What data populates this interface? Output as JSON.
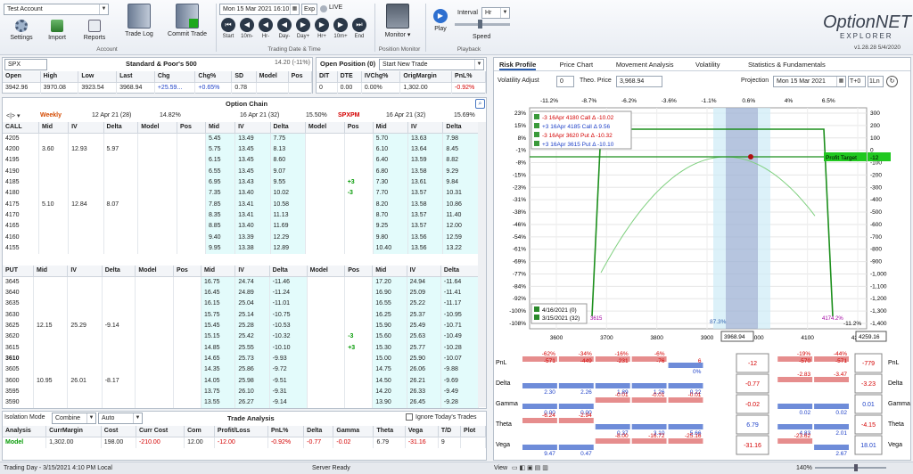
{
  "ribbon": {
    "account": "Test Account",
    "buttons": {
      "settings": "Settings",
      "import": "Import",
      "reports": "Reports",
      "trade_log": "Trade Log",
      "commit": "Commit Trade",
      "monitor": "Monitor",
      "play": "Play",
      "speed": "Speed"
    },
    "groups": {
      "account": "Account",
      "trading": "Trading Date & Time",
      "position_monitor": "Position Monitor",
      "playback": "Playback"
    },
    "datetime": "Mon 15 Mar 2021 16:10",
    "exp": "Exp",
    "live": "LIVE",
    "nav": [
      "Start",
      "10m-",
      "Hr-",
      "Day-",
      "Day+",
      "Hr+",
      "10m+",
      "End"
    ],
    "interval_label": "Interval",
    "interval": "Hr",
    "logo_main": "OptionNET",
    "logo_sub": "EXPLORER",
    "version": "v1.28.28  5/4/2020"
  },
  "symbol": {
    "sym": "SPX",
    "name": "Standard & Poor's 500",
    "iv": "14.20 (-11%)",
    "headers": [
      "Open",
      "High",
      "Low",
      "Last",
      "Chg",
      "Chg%",
      "SD",
      "Model",
      "Pos"
    ],
    "values": [
      "3942.96",
      "3970.08",
      "3923.54",
      "3968.94",
      "+25.59...",
      "+0.65%",
      "0.78",
      "",
      ""
    ]
  },
  "open_pos": {
    "title": "Open Position (0)",
    "trade": "Start New Trade",
    "headers": [
      "DIT",
      "DTE",
      "IVChg%",
      "OrigMargin",
      "PnL%"
    ],
    "values": [
      "0",
      "0.00",
      "0.00%",
      "1,302.00",
      "-0.92%"
    ]
  },
  "chain": {
    "title": "Option Chain",
    "series1": "Weekly",
    "exp1": "12 Apr 21 (28)",
    "iv1": "14.82%",
    "exp2": "16 Apr 21 (32)",
    "iv2": "15.50%",
    "series3": "SPXPM",
    "exp3": "16 Apr 21 (32)",
    "iv3": "15.69%",
    "call_headers": [
      "CALL",
      "Mid",
      "IV",
      "Delta",
      "Model",
      "Pos",
      "Mid",
      "IV",
      "Delta",
      "Model",
      "Pos",
      "Mid",
      "IV",
      "Delta"
    ],
    "put_headers": [
      "PUT",
      "Mid",
      "IV",
      "Delta",
      "Model",
      "Pos",
      "Mid",
      "IV",
      "Delta",
      "Model",
      "Pos",
      "Mid",
      "IV",
      "Delta"
    ],
    "calls": [
      [
        "4205",
        "",
        "",
        "",
        "",
        "",
        "5.45",
        "13.49",
        "7.75",
        "",
        "",
        "5.70",
        "13.63",
        "7.98"
      ],
      [
        "4200",
        "3.60",
        "12.93",
        "5.97",
        "",
        "",
        "5.75",
        "13.45",
        "8.13",
        "",
        "",
        "6.10",
        "13.64",
        "8.45"
      ],
      [
        "4195",
        "",
        "",
        "",
        "",
        "",
        "6.15",
        "13.45",
        "8.60",
        "",
        "",
        "6.40",
        "13.59",
        "8.82"
      ],
      [
        "4190",
        "",
        "",
        "",
        "",
        "",
        "6.55",
        "13.45",
        "9.07",
        "",
        "",
        "6.80",
        "13.58",
        "9.29"
      ],
      [
        "4185",
        "",
        "",
        "",
        "",
        "",
        "6.95",
        "13.43",
        "9.55",
        "",
        "+3",
        "7.30",
        "13.61",
        "9.84"
      ],
      [
        "4180",
        "",
        "",
        "",
        "",
        "",
        "7.35",
        "13.40",
        "10.02",
        "",
        "-3",
        "7.70",
        "13.57",
        "10.31"
      ],
      [
        "4175",
        "5.10",
        "12.84",
        "8.07",
        "",
        "",
        "7.85",
        "13.41",
        "10.58",
        "",
        "",
        "8.20",
        "13.58",
        "10.86"
      ],
      [
        "4170",
        "",
        "",
        "",
        "",
        "",
        "8.35",
        "13.41",
        "11.13",
        "",
        "",
        "8.70",
        "13.57",
        "11.40"
      ],
      [
        "4165",
        "",
        "",
        "",
        "",
        "",
        "8.85",
        "13.40",
        "11.69",
        "",
        "",
        "9.25",
        "13.57",
        "12.00"
      ],
      [
        "4160",
        "",
        "",
        "",
        "",
        "",
        "9.40",
        "13.39",
        "12.29",
        "",
        "",
        "9.80",
        "13.56",
        "12.59"
      ],
      [
        "4155",
        "",
        "",
        "",
        "",
        "",
        "9.95",
        "13.38",
        "12.89",
        "",
        "",
        "10.40",
        "13.56",
        "13.22"
      ]
    ],
    "puts": [
      [
        "3645",
        "",
        "",
        "",
        "",
        "",
        "16.75",
        "24.74",
        "-11.46",
        "",
        "",
        "17.20",
        "24.94",
        "-11.64"
      ],
      [
        "3640",
        "",
        "",
        "",
        "",
        "",
        "16.45",
        "24.89",
        "-11.24",
        "",
        "",
        "16.90",
        "25.09",
        "-11.41"
      ],
      [
        "3635",
        "",
        "",
        "",
        "",
        "",
        "16.15",
        "25.04",
        "-11.01",
        "",
        "",
        "16.55",
        "25.22",
        "-11.17"
      ],
      [
        "3630",
        "",
        "",
        "",
        "",
        "",
        "15.75",
        "25.14",
        "-10.75",
        "",
        "",
        "16.25",
        "25.37",
        "-10.95"
      ],
      [
        "3625",
        "12.15",
        "25.29",
        "-9.14",
        "",
        "",
        "15.45",
        "25.28",
        "-10.53",
        "",
        "",
        "15.90",
        "25.49",
        "-10.71"
      ],
      [
        "3620",
        "",
        "",
        "",
        "",
        "",
        "15.15",
        "25.42",
        "-10.32",
        "",
        "-3",
        "15.60",
        "25.63",
        "-10.49"
      ],
      [
        "3615",
        "",
        "",
        "",
        "",
        "",
        "14.85",
        "25.55",
        "-10.10",
        "",
        "+3",
        "15.30",
        "25.77",
        "-10.28"
      ],
      [
        "3610",
        "",
        "",
        "",
        "",
        "",
        "14.65",
        "25.73",
        "-9.93",
        "",
        "",
        "15.00",
        "25.90",
        "-10.07"
      ],
      [
        "3605",
        "",
        "",
        "",
        "",
        "",
        "14.35",
        "25.86",
        "-9.72",
        "",
        "",
        "14.75",
        "26.06",
        "-9.88"
      ],
      [
        "3600",
        "10.95",
        "26.01",
        "-8.17",
        "",
        "",
        "14.05",
        "25.98",
        "-9.51",
        "",
        "",
        "14.50",
        "26.21",
        "-9.69"
      ],
      [
        "3595",
        "",
        "",
        "",
        "",
        "",
        "13.75",
        "26.10",
        "-9.31",
        "",
        "",
        "14.20",
        "26.33",
        "-9.49"
      ],
      [
        "3590",
        "",
        "",
        "",
        "",
        "",
        "13.55",
        "26.27",
        "-9.14",
        "",
        "",
        "13.90",
        "26.45",
        "-9.28"
      ]
    ]
  },
  "analysis": {
    "title": "Trade Analysis",
    "iso_label": "Isolation Mode",
    "iso": "Combine",
    "auto": "Auto",
    "ignore": "Ignore Today's Trades",
    "headers": [
      "Analysis",
      "CurrMargin",
      "Cost",
      "Curr Cost",
      "Com",
      "Profit/Loss",
      "PnL%",
      "Delta",
      "Gamma",
      "Theta",
      "Vega",
      "T/D",
      "Plot"
    ],
    "values": [
      "Model",
      "1,302.00",
      "198.00",
      "-210.00",
      "12.00",
      "-12.00",
      "-0.92%",
      "-0.77",
      "-0.02",
      "6.79",
      "-31.16",
      "9",
      ""
    ]
  },
  "status": {
    "left": "Trading Day - 3/15/2021 4:10 PM Local",
    "server": "Server Ready",
    "view": "View",
    "zoom": "140%"
  },
  "right": {
    "tabs": [
      "Risk Profile",
      "Price Chart",
      "Movement Analysis",
      "Volatility",
      "Statistics & Fundamentals"
    ],
    "vol_adj_label": "Volatility Adjust",
    "vol_adj": "0",
    "theo_label": "Theo. Price",
    "theo": "3,968.94",
    "proj_label": "Projection",
    "proj": "Mon 15 Mar 2021",
    "tplus": "T+0",
    "ln": "1Ln",
    "top_pcts": [
      "-11.2%",
      "-8.7%",
      "-6.2%",
      "-3.6%",
      "-1.1%",
      "0.6%",
      "4%",
      "6.5%"
    ],
    "left_axis": [
      "23%",
      "15%",
      "8%",
      "-1%",
      "-8%",
      "-15%",
      "-23%",
      "-31%",
      "-38%",
      "-46%",
      "-54%",
      "-61%",
      "-69%",
      "-77%",
      "-84%",
      "-92%",
      "-100%",
      "-108%"
    ],
    "right_axis": [
      "300",
      "200",
      "100",
      "0",
      "-100",
      "-200",
      "-300",
      "-400",
      "-500",
      "-600",
      "-700",
      "-800",
      "-900",
      "-1,000",
      "-1,100",
      "-1,200",
      "-1,300",
      "-1,400"
    ],
    "x_axis": [
      "3600",
      "3700",
      "3800",
      "3900",
      "4000",
      "4100",
      "4200"
    ],
    "price_box": "3968.94",
    "right_box": "4259.16",
    "legend": [
      "-3 16Apr 4180 Call Δ  -10.02",
      "+3 16Apr 4185 Call Δ    9.56",
      "-3 16Apr 3620 Put Δ  -10.32",
      "+3 16Apr 3615 Put Δ  -10.10"
    ],
    "legend2": [
      "4/16/2021 (0)",
      "3/15/2021 (32)"
    ],
    "profit_target": "Profit Target",
    "pt_val": "-12",
    "band_label": "87.3%",
    "left_label": "3615",
    "right_label": "4174.2%",
    "bottom_right": "-11.2%",
    "greeks": {
      "rows": [
        "PnL",
        "Delta",
        "Gamma",
        "Theta",
        "Vega"
      ],
      "pnl": [
        "-62%",
        "-34%",
        "-16%",
        "-6%",
        "0%",
        "",
        "",
        "-19%",
        "-44%"
      ],
      "pnl2": [
        "-571",
        "-449",
        "-231",
        "-76",
        "6",
        "",
        "",
        "-570",
        "-571"
      ],
      "center": [
        "-12\n-0.9%",
        "-0.77",
        "-0.02",
        "6.79",
        "-31.16"
      ],
      "right": [
        "-779\n-60%",
        "-3.23",
        "0.01",
        "-4.15",
        "18.01"
      ],
      "delta": [
        "2.30",
        "2.26",
        "1.89",
        "1.26",
        "0.22",
        "",
        "",
        "-2.83",
        "-3.47"
      ],
      "gamma": [
        "0.00",
        "0.00",
        "-0.01",
        "-0.01",
        "-0.01",
        "",
        "",
        "0.02",
        "0.02"
      ],
      "theta": [
        "-6.24",
        "-2.94",
        "0.37",
        "3.10",
        "5.66",
        "",
        "",
        "4.83",
        "2.01"
      ],
      "vega": [
        "9.47",
        "0.47",
        "-8.00",
        "-16.72",
        "-25.16",
        "",
        "",
        "-23.62",
        "2.67"
      ]
    }
  }
}
